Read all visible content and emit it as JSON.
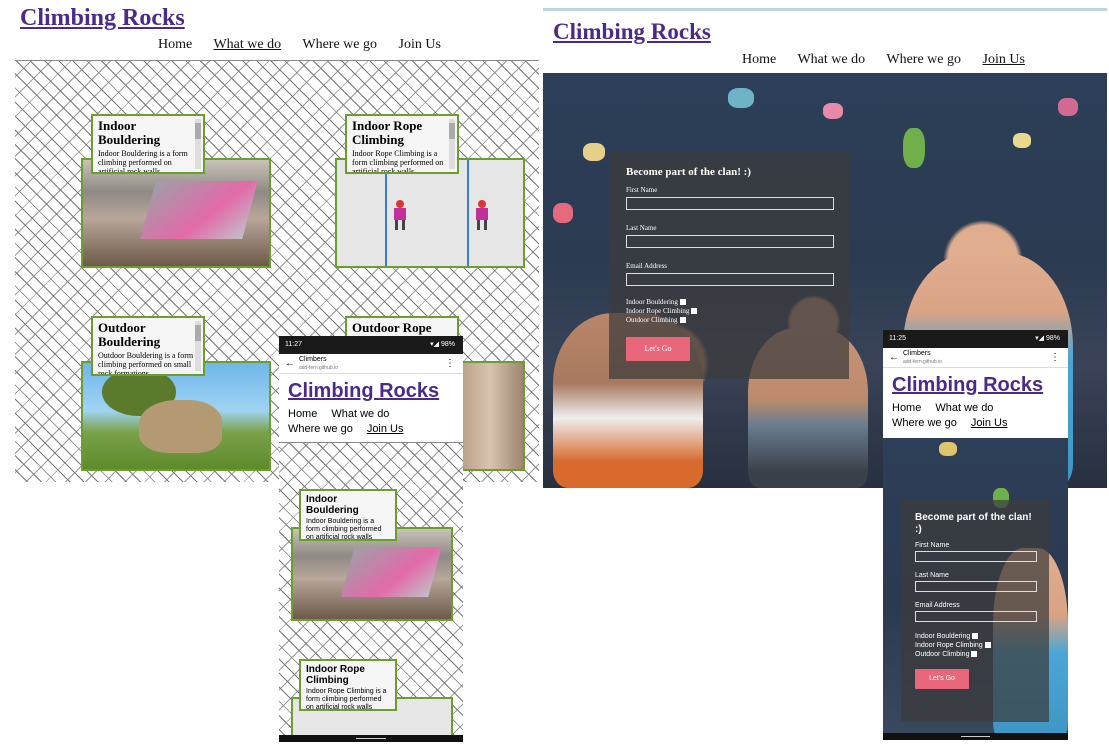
{
  "site_title": "Climbing Rocks",
  "nav": [
    "Home",
    "What we do",
    "Where we go",
    "Join Us"
  ],
  "cards": [
    {
      "title": "Indoor Bouldering",
      "text": "Indoor Bouldering is a form climbing performed on artificial rock walls"
    },
    {
      "title": "Indoor Rope Climbing",
      "text": "Indoor Rope Climbing is a form climbing performed on artificial rock walls"
    },
    {
      "title": "Outdoor Bouldering",
      "text": "Outdoor Bouldering is a form climbing performed on small rock formations"
    },
    {
      "title": "Outdoor Rope",
      "text": ""
    }
  ],
  "mobile_cards": [
    {
      "title": "Indoor Bouldering",
      "text": "Indoor Bouldering is a form climbing performed on artificial rock walls without the use of ropes or"
    },
    {
      "title": "Indoor Rope Climbing",
      "text": "Indoor Rope Climbing is a form climbing performed on artificial rock walls"
    }
  ],
  "mobile_browser": {
    "time_a": "11:27",
    "time_b": "11:25",
    "battery": "98%",
    "page_title": "Climbers",
    "url": "add-fern.github.io"
  },
  "form": {
    "heading": "Become part of the clan! :)",
    "first_name_label": "First Name",
    "last_name_label": "Last Name",
    "email_label": "Email Address",
    "options": [
      "Indoor Bouldering",
      "Indoor Rope Climbing",
      "Outdoor Climbing"
    ],
    "submit": "Let's Go"
  },
  "colors": {
    "title": "#4b2a8a",
    "card_border": "#6a9f2f",
    "button": "#e9677a"
  }
}
